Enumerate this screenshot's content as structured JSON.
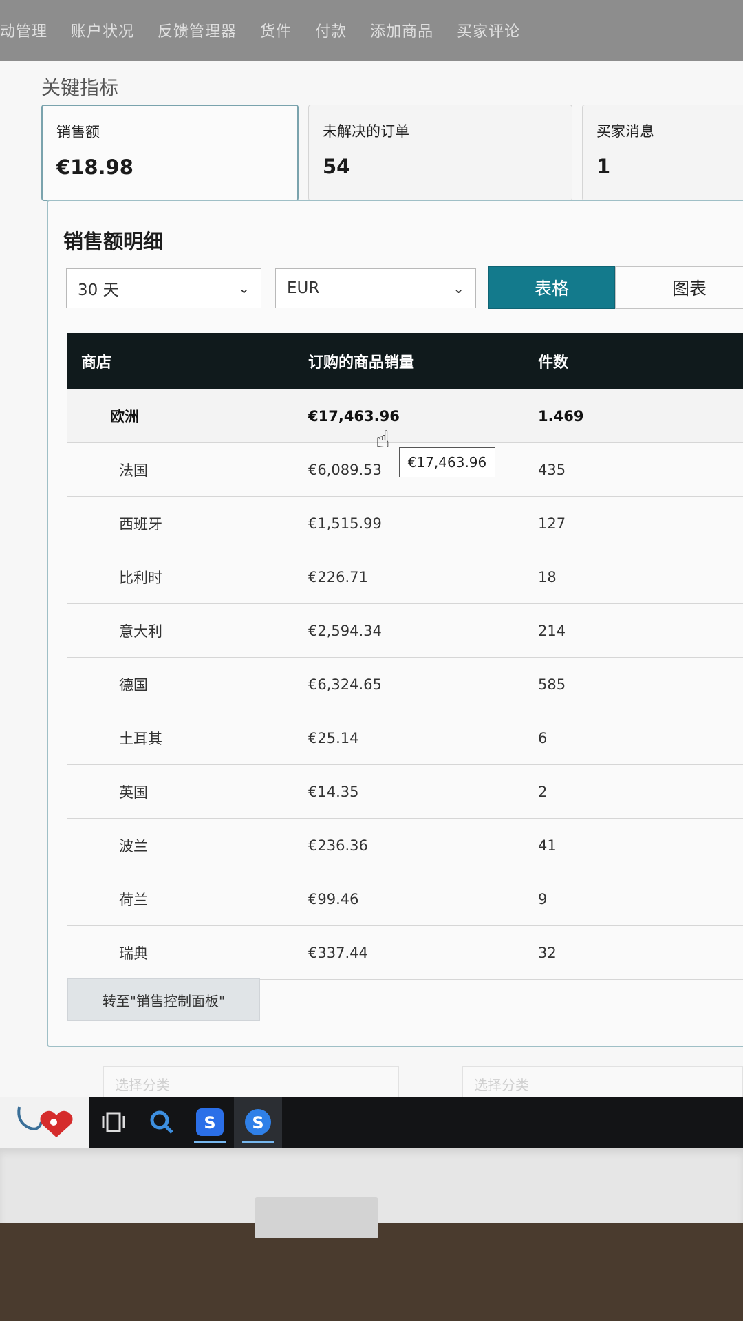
{
  "nav": {
    "items": [
      "动管理",
      "账户状况",
      "反馈管理器",
      "货件",
      "付款",
      "添加商品",
      "买家评论"
    ]
  },
  "key_metrics": {
    "title": "关键指标",
    "cards": [
      {
        "label": "销售额",
        "value": "€18.98"
      },
      {
        "label": "未解决的订单",
        "value": "54"
      },
      {
        "label": "买家消息",
        "value": "1"
      }
    ]
  },
  "panel": {
    "title": "销售额明细",
    "period_select": "30 天",
    "currency_select": "EUR",
    "view_toggle": {
      "table": "表格",
      "chart": "图表",
      "selected": "表格"
    },
    "table": {
      "columns": [
        "商店",
        "订购的商品销量",
        "件数"
      ],
      "rows": [
        {
          "store": "欧洲",
          "sales": "€17,463.96",
          "units": "1.469",
          "type": "parent"
        },
        {
          "store": "法国",
          "sales": "€6,089.53",
          "units": "435"
        },
        {
          "store": "西班牙",
          "sales": "€1,515.99",
          "units": "127"
        },
        {
          "store": "比利时",
          "sales": "€226.71",
          "units": "18"
        },
        {
          "store": "意大利",
          "sales": "€2,594.34",
          "units": "214"
        },
        {
          "store": "德国",
          "sales": "€6,324.65",
          "units": "585"
        },
        {
          "store": "土耳其",
          "sales": "€25.14",
          "units": "6"
        },
        {
          "store": "英国",
          "sales": "€14.35",
          "units": "2"
        },
        {
          "store": "波兰",
          "sales": "€236.36",
          "units": "41"
        },
        {
          "store": "荷兰",
          "sales": "€99.46",
          "units": "9"
        },
        {
          "store": "瑞典",
          "sales": "€337.44",
          "units": "32"
        }
      ]
    },
    "tooltip": "€17,463.96",
    "goto_button": "转至\"销售控制面板\""
  },
  "below_panel": {
    "left_select": "选择分类",
    "right_select": "选择分类"
  },
  "taskbar": {
    "icons": [
      "health-app-icon",
      "task-view-icon",
      "search-icon",
      "sogou-app-icon",
      "browser-app-icon"
    ]
  },
  "colors": {
    "accent": "#137a8c",
    "table_header": "#101a1c",
    "panel_border": "#9fbfc6"
  }
}
